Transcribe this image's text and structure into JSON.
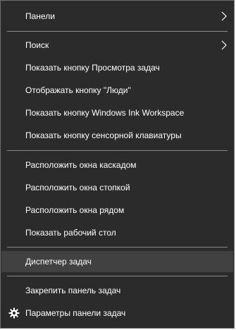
{
  "menu": {
    "items": [
      {
        "label": "Панели",
        "submenu": true
      },
      {
        "label": "Поиск",
        "submenu": true
      },
      {
        "label": "Показать кнопку Просмотра задач"
      },
      {
        "label": "Отображать кнопку \"Люди\""
      },
      {
        "label": "Показать кнопку Windows Ink Workspace"
      },
      {
        "label": "Показать кнопку сенсорной клавиатуры"
      },
      {
        "label": "Расположить окна каскадом"
      },
      {
        "label": "Расположить окна стопкой"
      },
      {
        "label": "Расположить окна рядом"
      },
      {
        "label": "Показать рабочий стол"
      },
      {
        "label": "Диспетчер задач",
        "highlighted": true
      },
      {
        "label": "Закрепить панель задач"
      },
      {
        "label": "Параметры панели задач",
        "icon": "gear-icon"
      }
    ]
  },
  "colors": {
    "background": "#2b2b2b",
    "highlight": "#414141",
    "text": "#ffffff",
    "separator": "#8a8a8a"
  }
}
